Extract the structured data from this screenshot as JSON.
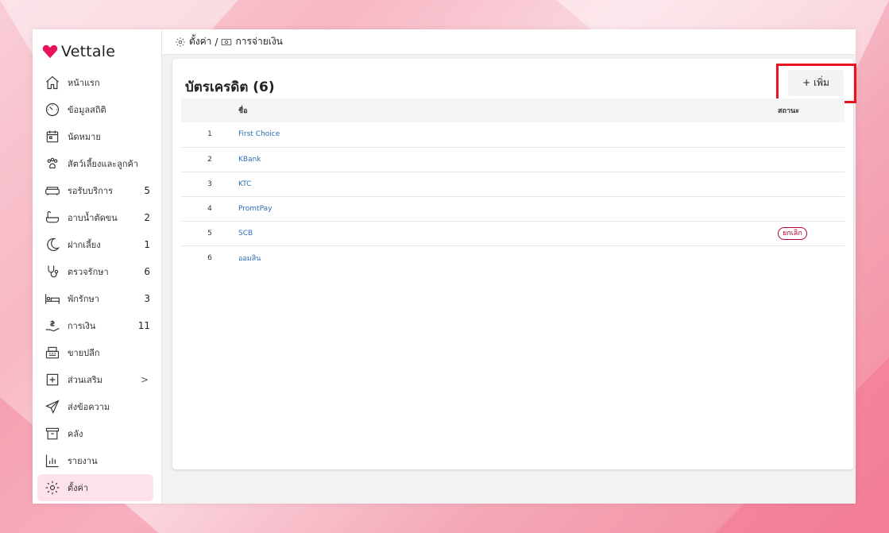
{
  "app": {
    "name": "Vettale"
  },
  "breadcrumb": {
    "settings": "ตั้งค่า",
    "separator": "/",
    "payment": "การจ่ายเงิน"
  },
  "sidebar": {
    "items": [
      {
        "label": "หน้าแรก",
        "icon": "home-icon",
        "count": ""
      },
      {
        "label": "ข้อมูลสถิติ",
        "icon": "dashboard-gauge-icon",
        "count": ""
      },
      {
        "label": "นัดหมาย",
        "icon": "calendar-icon",
        "count": ""
      },
      {
        "label": "สัตว์เลี้ยงและลูกค้า",
        "icon": "paw-icon",
        "count": ""
      },
      {
        "label": "รอรับบริการ",
        "icon": "sofa-icon",
        "count": "5"
      },
      {
        "label": "อาบน้ำตัดขน",
        "icon": "bathtub-icon",
        "count": "2"
      },
      {
        "label": "ฝากเลี้ยง",
        "icon": "moon-icon",
        "count": "1"
      },
      {
        "label": "ตรวจรักษา",
        "icon": "stethoscope-icon",
        "count": "6"
      },
      {
        "label": "พักรักษา",
        "icon": "bed-icon",
        "count": "3"
      },
      {
        "label": "การเงิน",
        "icon": "money-hand-icon",
        "count": "11"
      },
      {
        "label": "ขายปลีก",
        "icon": "cash-register-icon",
        "count": ""
      },
      {
        "label": "ส่วนเสริม",
        "icon": "plus-square-icon",
        "count": "",
        "chevron": ">"
      },
      {
        "label": "ส่งข้อความ",
        "icon": "paper-plane-icon",
        "count": ""
      },
      {
        "label": "คลัง",
        "icon": "archive-box-icon",
        "count": ""
      },
      {
        "label": "รายงาน",
        "icon": "bar-chart-icon",
        "count": ""
      },
      {
        "label": "ตั้งค่า",
        "icon": "gear-icon",
        "count": "",
        "active": true
      }
    ]
  },
  "card": {
    "title": "บัตรเครดิต (6)",
    "add_label": "+ เพิ่ม",
    "columns": {
      "index": "",
      "name": "ชื่อ",
      "status": "สถานะ"
    },
    "rows": [
      {
        "index": "1",
        "name": "First Choice",
        "status": ""
      },
      {
        "index": "2",
        "name": "KBank",
        "status": ""
      },
      {
        "index": "3",
        "name": "KTC",
        "status": ""
      },
      {
        "index": "4",
        "name": "PromtPay",
        "status": ""
      },
      {
        "index": "5",
        "name": "SCB",
        "status": "ยกเลิก"
      },
      {
        "index": "6",
        "name": "ออมสิน",
        "status": ""
      }
    ]
  },
  "colors": {
    "accent": "#e8145a",
    "highlight": "#e8141d",
    "link": "#2f6db5",
    "active_bg": "#fde2ee"
  }
}
